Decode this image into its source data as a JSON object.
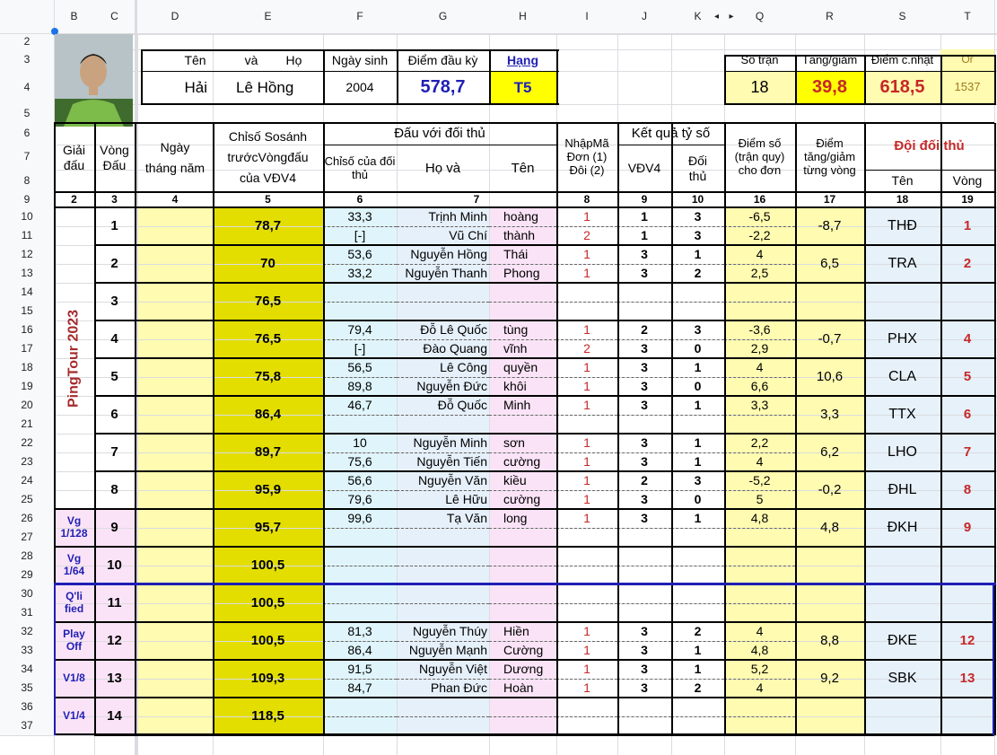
{
  "col_headers": {
    "B": "B",
    "C": "C",
    "D": "D",
    "E": "E",
    "F": "F",
    "G": "G",
    "H": "H",
    "I": "I",
    "J": "J",
    "K": "K",
    "Q": "Q",
    "R": "R",
    "S": "S",
    "T": "T"
  },
  "row_numbers": [
    "2",
    "3",
    "4",
    "5",
    "6",
    "7",
    "8",
    "9",
    "10",
    "11",
    "12",
    "13",
    "14",
    "15",
    "16",
    "17",
    "18",
    "19",
    "20",
    "21",
    "22",
    "23",
    "24",
    "25",
    "26",
    "27",
    "28",
    "29",
    "30",
    "31",
    "32",
    "33",
    "34",
    "35",
    "36",
    "37"
  ],
  "player": {
    "name_label_1": "Tên",
    "name_label_2": "và",
    "name_label_3": "Họ",
    "first_name": "Hải",
    "last_name": "Lê Hồng",
    "dob_label": "Ngày sinh",
    "dob": "2004",
    "start_score_label": "Điểm đầu kỳ",
    "start_score": "578,7",
    "rank_label": "Hạng",
    "rank": "T5"
  },
  "summary": {
    "matches_label": "Số trận",
    "matches": "18",
    "change_label": "Tăng/giảm",
    "change": "39,8",
    "updated_label": "Điểm c.nhật",
    "updated": "618,5",
    "or_label": "Or",
    "or_value": "1537"
  },
  "headers": {
    "tournament": "Giải đấu",
    "round": "Vòng Đấu",
    "date": "Ngày tháng năm",
    "compare_index": "Chỉsố Sosánh trướcVòngđấu của VĐV4",
    "vs_opponent": "Đấu với đối thủ",
    "opp_index": "Chỉsố của đối thủ",
    "ho_va": "Họ và",
    "ten": "Tên",
    "input_code": "NhậpMã Đơn (1) Đôi (2)",
    "result": "Kết quả tỷ số",
    "vdv4": "VĐV4",
    "opp": "Đối thủ",
    "points": "Điểm số (trận quy) cho đơn",
    "change_round": "Điểm tăng/giảm từng vòng",
    "opp_team": "Đội đối thủ",
    "team_name": "Tên",
    "team_round": "Vòng"
  },
  "col_numbers": [
    "2",
    "3",
    "4",
    "5",
    "6",
    "7",
    "8",
    "9",
    "10",
    "16",
    "17",
    "18",
    "19"
  ],
  "tournament_name": "PingTour 2023",
  "round_labels": {
    "vg128": "Vg 1/128",
    "vg64": "Vg 1/64",
    "qualified": "Q'li fied",
    "playoff": "Play Off",
    "v18": "V1/8",
    "v14": "V1/4"
  },
  "rounds": [
    {
      "round": "1",
      "index": "78,7",
      "change": "-8,7",
      "team": "THĐ",
      "team_round": "1",
      "lines": [
        {
          "opp_index": "33,3",
          "ho": "Trịnh Minh",
          "ten": "hoàng",
          "code": "1",
          "v": "1",
          "o": "3",
          "pts": "-6,5"
        },
        {
          "opp_index": "[-]",
          "ho": "Vũ Chí",
          "ten": "thành",
          "code": "2",
          "v": "1",
          "o": "3",
          "pts": "-2,2"
        }
      ]
    },
    {
      "round": "2",
      "index": "70",
      "change": "6,5",
      "team": "TRA",
      "team_round": "2",
      "lines": [
        {
          "opp_index": "53,6",
          "ho": "Nguyễn Hồng",
          "ten": "Thái",
          "code": "1",
          "v": "3",
          "o": "1",
          "pts": "4"
        },
        {
          "opp_index": "33,2",
          "ho": "Nguyễn Thanh",
          "ten": "Phong",
          "code": "1",
          "v": "3",
          "o": "2",
          "pts": "2,5"
        }
      ]
    },
    {
      "round": "3",
      "index": "76,5",
      "change": "",
      "team": "",
      "team_round": "",
      "lines": []
    },
    {
      "round": "4",
      "index": "76,5",
      "change": "-0,7",
      "team": "PHX",
      "team_round": "4",
      "lines": [
        {
          "opp_index": "79,4",
          "ho": "Đỗ Lê Quốc",
          "ten": "tùng",
          "code": "1",
          "v": "2",
          "o": "3",
          "pts": "-3,6"
        },
        {
          "opp_index": "[-]",
          "ho": "Đào Quang",
          "ten": "vĩnh",
          "code": "2",
          "v": "3",
          "o": "0",
          "pts": "2,9"
        }
      ]
    },
    {
      "round": "5",
      "index": "75,8",
      "change": "10,6",
      "team": "CLA",
      "team_round": "5",
      "lines": [
        {
          "opp_index": "56,5",
          "ho": "Lê Công",
          "ten": "quyền",
          "code": "1",
          "v": "3",
          "o": "1",
          "pts": "4"
        },
        {
          "opp_index": "89,8",
          "ho": "Nguyễn Đức",
          "ten": "khôi",
          "code": "1",
          "v": "3",
          "o": "0",
          "pts": "6,6"
        }
      ]
    },
    {
      "round": "6",
      "index": "86,4",
      "change": "3,3",
      "team": "TTX",
      "team_round": "6",
      "lines": [
        {
          "opp_index": "46,7",
          "ho": "Đỗ Quốc",
          "ten": "Minh",
          "code": "1",
          "v": "3",
          "o": "1",
          "pts": "3,3"
        }
      ]
    },
    {
      "round": "7",
      "index": "89,7",
      "change": "6,2",
      "team": "LHO",
      "team_round": "7",
      "lines": [
        {
          "opp_index": "10",
          "ho": "Nguyễn Minh",
          "ten": "sơn",
          "code": "1",
          "v": "3",
          "o": "1",
          "pts": "2,2"
        },
        {
          "opp_index": "75,6",
          "ho": "Nguyễn Tiến",
          "ten": "cường",
          "code": "1",
          "v": "3",
          "o": "1",
          "pts": "4"
        }
      ]
    },
    {
      "round": "8",
      "index": "95,9",
      "change": "-0,2",
      "team": "ĐHL",
      "team_round": "8",
      "lines": [
        {
          "opp_index": "56,6",
          "ho": "Nguyễn Văn",
          "ten": "kiều",
          "code": "1",
          "v": "2",
          "o": "3",
          "pts": "-5,2"
        },
        {
          "opp_index": "79,6",
          "ho": "Lê Hữu",
          "ten": "cường",
          "code": "1",
          "v": "3",
          "o": "0",
          "pts": "5"
        }
      ]
    },
    {
      "round": "9",
      "index": "95,7",
      "change": "4,8",
      "team": "ĐKH",
      "team_round": "9",
      "lines": [
        {
          "opp_index": "99,6",
          "ho": "Tạ Văn",
          "ten": "long",
          "code": "1",
          "v": "3",
          "o": "1",
          "pts": "4,8"
        }
      ]
    },
    {
      "round": "10",
      "index": "100,5",
      "change": "",
      "team": "",
      "team_round": "",
      "lines": []
    },
    {
      "round": "11",
      "index": "100,5",
      "change": "",
      "team": "",
      "team_round": "",
      "lines": []
    },
    {
      "round": "12",
      "index": "100,5",
      "change": "8,8",
      "team": "ĐKE",
      "team_round": "12",
      "lines": [
        {
          "opp_index": "81,3",
          "ho": "Nguyễn Thúy",
          "ten": "Hiền",
          "code": "1",
          "v": "3",
          "o": "2",
          "pts": "4"
        },
        {
          "opp_index": "86,4",
          "ho": "Nguyễn Mạnh",
          "ten": "Cường",
          "code": "1",
          "v": "3",
          "o": "1",
          "pts": "4,8"
        }
      ]
    },
    {
      "round": "13",
      "index": "109,3",
      "change": "9,2",
      "team": "SBK",
      "team_round": "13",
      "lines": [
        {
          "opp_index": "91,5",
          "ho": "Nguyễn Việt",
          "ten": "Dương",
          "code": "1",
          "v": "3",
          "o": "1",
          "pts": "5,2"
        },
        {
          "opp_index": "84,7",
          "ho": "Phan Đức",
          "ten": "Hoàn",
          "code": "1",
          "v": "3",
          "o": "2",
          "pts": "4"
        }
      ]
    },
    {
      "round": "14",
      "index": "118,5",
      "change": "",
      "team": "",
      "team_round": "",
      "lines": []
    }
  ],
  "colors": {
    "yellow": "#ffff00",
    "olive_yellow": "#e3de00",
    "light_yellow": "#fffbb0",
    "light_blue": "#dff5fb",
    "light_pink": "#fbe3f7",
    "pale_blue": "#e6f0fa",
    "team_bg": "#e6f1fa",
    "accent_red": "#c62828",
    "accent_blue": "#1f1fb4"
  }
}
